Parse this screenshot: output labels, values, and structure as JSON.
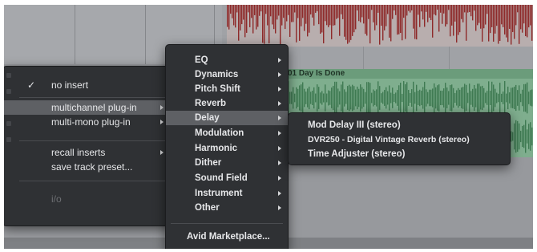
{
  "track": {
    "clip_name": "01 Day Is Done"
  },
  "insert_menu": {
    "items": [
      {
        "label": "no insert",
        "checked": true
      },
      {
        "label": "multichannel plug-in",
        "submenu": true,
        "highlighted": true
      },
      {
        "label": "multi-mono plug-in",
        "submenu": true
      },
      {
        "label": "recall inserts",
        "submenu": true
      },
      {
        "label": "save track preset..."
      },
      {
        "label": "i/o",
        "disabled": true
      }
    ]
  },
  "category_menu": {
    "items": [
      {
        "label": "EQ"
      },
      {
        "label": "Dynamics"
      },
      {
        "label": "Pitch Shift"
      },
      {
        "label": "Reverb"
      },
      {
        "label": "Delay",
        "highlighted": true
      },
      {
        "label": "Modulation"
      },
      {
        "label": "Harmonic"
      },
      {
        "label": "Dither"
      },
      {
        "label": "Sound Field"
      },
      {
        "label": "Instrument"
      },
      {
        "label": "Other"
      }
    ],
    "marketplace": "Avid Marketplace..."
  },
  "plugin_menu": {
    "items": [
      {
        "label": "Mod Delay III (stereo)"
      },
      {
        "label": "DVR250 - Digital Vintage Reverb (stereo)"
      },
      {
        "label": "Time Adjuster (stereo)"
      }
    ]
  },
  "colors": {
    "menu_bg": "#2f3134",
    "highlight": "#5e6064",
    "clip_green": "#7fae8e",
    "clip_red": "#8e2a2a"
  }
}
